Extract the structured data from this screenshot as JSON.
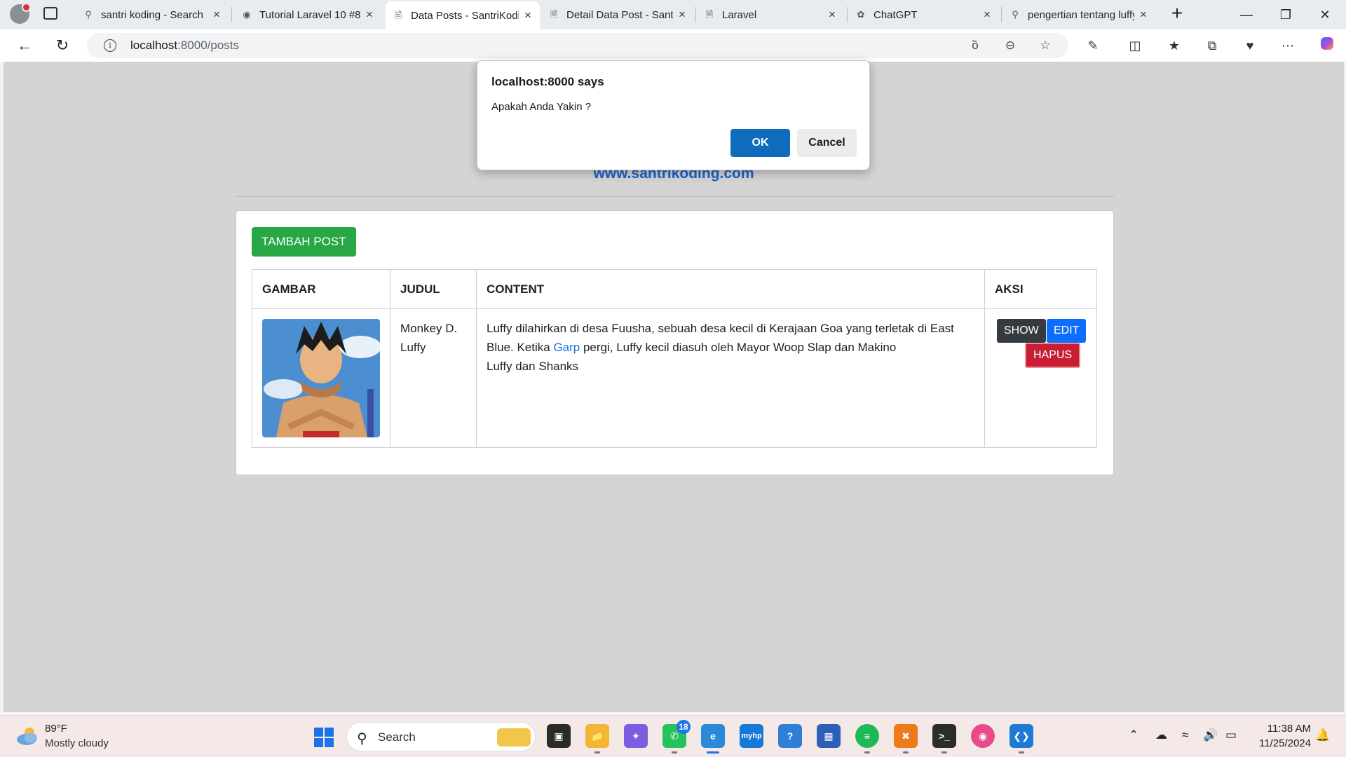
{
  "browser": {
    "tabs": [
      {
        "title": "santri koding - Search",
        "icon": "search-icon"
      },
      {
        "title": "Tutorial Laravel 10 #8",
        "icon": "github-icon"
      },
      {
        "title": "Data Posts - SantriKoding",
        "icon": "page-icon",
        "active": true
      },
      {
        "title": "Detail Data Post - SantriKoding",
        "icon": "page-icon"
      },
      {
        "title": "Laravel",
        "icon": "page-icon"
      },
      {
        "title": "ChatGPT",
        "icon": "chatgpt-icon"
      },
      {
        "title": "pengertian tentang luffy",
        "icon": "search-icon"
      }
    ],
    "url_host": "localhost",
    "url_rest": ":8000/posts"
  },
  "page": {
    "site_link": "www.santrikoding.com",
    "add_button": "TAMBAH POST",
    "table": {
      "headers": [
        "GAMBAR",
        "JUDUL",
        "CONTENT",
        "AKSI"
      ],
      "rows": [
        {
          "judul": "Monkey D. Luffy",
          "content_before": "Luffy dilahirkan di desa Fuusha, sebuah desa kecil di Kerajaan Goa yang terletak di East Blue. Ketika ",
          "content_link": "Garp",
          "content_after": " pergi, Luffy kecil diasuh oleh Mayor Woop Slap dan Makino",
          "content_line2": "Luffy dan Shanks",
          "show_label": "SHOW",
          "edit_label": "EDIT",
          "delete_label": "HAPUS"
        }
      ]
    }
  },
  "dialog": {
    "title": "localhost:8000 says",
    "message": "Apakah Anda Yakin ?",
    "ok_label": "OK",
    "cancel_label": "Cancel"
  },
  "taskbar": {
    "weather_temp": "89°F",
    "weather_desc": "Mostly cloudy",
    "search_label": "Search",
    "whatsapp_badge": "18",
    "clock_time": "11:38 AM",
    "clock_date": "11/25/2024"
  },
  "colors": {
    "success": "#28a745",
    "dark": "#343a40",
    "primary": "#0d6efd",
    "danger": "#c81e33",
    "dialog_ok": "#0f6cbd"
  }
}
